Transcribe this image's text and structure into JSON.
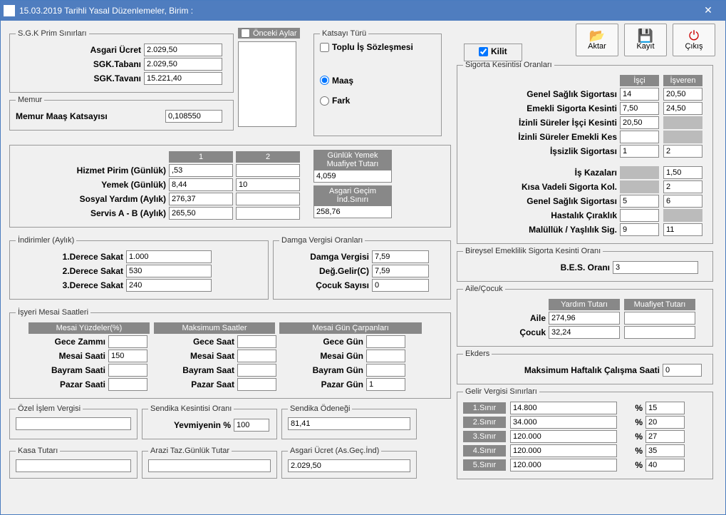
{
  "title": "15.03.2019 Tarihli Yasal Düzenlemeler, Birim :",
  "toolbar": {
    "aktar": "Aktar",
    "kayit": "Kayıt",
    "cikis": "Çıkış"
  },
  "sgk": {
    "legend": "S.G.K Prim Sınırları",
    "asgari_label": "Asgari Ücret",
    "asgari": "2.029,50",
    "taban_label": "SGK.Tabanı",
    "taban": "2.029,50",
    "tavan_label": "SGK.Tavanı",
    "tavan": "15.221,40"
  },
  "memur": {
    "legend": "Memur",
    "katsayi_label": "Memur Maaş Katsayısı",
    "katsayi": "0,108550"
  },
  "onceki": "Önceki Aylar",
  "katsayi": {
    "legend": "Katsayı Türü",
    "toplu": "Toplu İş Sözleşmesi",
    "maas": "Maaş",
    "fark": "Fark"
  },
  "kilit": "Kilit",
  "daily": {
    "col1": "1",
    "col2": "2",
    "hizmet_l": "Hizmet Pirim (Günlük)",
    "hizmet": ",53",
    "yemek_l": "Yemek (Günlük)",
    "yemek1": "8,44",
    "yemek2": "10",
    "sosyal_l": "Sosyal Yardım (Aylık)",
    "sosyal": "276,37",
    "servis_l": "Servis A - B  (Aylık)",
    "servis": "265,50",
    "gunluk_yemek_h": "Günlük Yemek Muafiyet Tutarı",
    "gunluk_yemek": "4,059",
    "asgari_gecim_h": "Asgari Geçim İnd.Sınırı",
    "asgari_gecim": "258,76"
  },
  "indirimler": {
    "legend": "İndirimler (Aylık)",
    "d1_l": "1.Derece Sakat",
    "d1": "1.000",
    "d2_l": "2.Derece Sakat",
    "d2": "530",
    "d3_l": "3.Derece Sakat",
    "d3": "240"
  },
  "damga": {
    "legend": "Damga Vergisi Oranları",
    "dv_l": "Damga Vergisi",
    "dv": "7,59",
    "dg_l": "Değ.Gelir(C)",
    "dg": "7,59",
    "cs_l": "Çocuk Sayısı",
    "cs": "0"
  },
  "mesai": {
    "legend": "İşyeri Mesai Saatleri",
    "h1": "Mesai Yüzdeler(%)",
    "h2": "Maksimum Saatler",
    "h3": "Mesai Gün Çarpanları",
    "gece_l": "Gece Zammı",
    "gece_s_l": "Gece Saat",
    "gece_g_l": "Gece Gün",
    "mesai_l": "Mesai Saati",
    "mesai_v": "150",
    "mesai_s_l": "Mesai Saat",
    "mesai_g_l": "Mesai Gün",
    "bayram_l": "Bayram Saati",
    "bayram_s_l": "Bayram Saat",
    "bayram_g_l": "Bayram Gün",
    "pazar_l": "Pazar Saati",
    "pazar_s_l": "Pazar Saat",
    "pazar_g_l": "Pazar Gün",
    "pazar_g_v": "1"
  },
  "ozel_islem": {
    "legend": "Özel İşlem Vergisi"
  },
  "sendika_k": {
    "legend": "Sendika Kesintisi Oranı",
    "yev_l": "Yevmiyenin %",
    "yev": "100"
  },
  "sendika_o": {
    "legend": "Sendika Ödeneği",
    "v": "81,41"
  },
  "kasa": {
    "legend": "Kasa Tutarı"
  },
  "arazi": {
    "legend": "Arazi Taz.Günlük Tutar"
  },
  "asgari_ind": {
    "legend": "Asgari Ücret (As.Geç.İnd)",
    "v": "2.029,50"
  },
  "sigorta": {
    "legend": "Sigorta Kesintisi Oranları",
    "isci_h": "İşçi",
    "isveren_h": "İşveren",
    "gss_l": "Genel Sağlık Sigortası",
    "gss_i": "14",
    "gss_v": "20,50",
    "emk_l": "Emekli Sigorta Kesinti",
    "emk_i": "7,50",
    "emk_v": "24,50",
    "izin_i_l": "İzinli Süreler İşçi Kesinti",
    "izin_i": "20,50",
    "izin_e_l": "İzinli Süreler Emekli Kes",
    "issiz_l": "İşsizlik Sigortası",
    "issiz_i": "1",
    "issiz_v": "2",
    "kaza_l": "İş Kazaları",
    "kaza_v": "1,50",
    "kisa_l": "Kısa Vadeli Sigorta Kol.",
    "kisa_v": "2",
    "gss2_l": "Genel Sağlık Sigortası",
    "gss2_i": "5",
    "gss2_v": "6",
    "hast_l": "Hastalık Çıraklık",
    "mal_l": "Malüllük / Yaşlılık Sig.",
    "mal_i": "9",
    "mal_v": "11"
  },
  "bes": {
    "legend": "Bireysel Emeklilik Sigorta Kesinti Oranı",
    "l": "B.E.S. Oranı",
    "v": "3"
  },
  "aile": {
    "legend": "Aile/Çocuk",
    "yardim_h": "Yardım Tutarı",
    "muaf_h": "Muafiyet Tutarı",
    "aile_l": "Aile",
    "aile_v": "274,96",
    "cocuk_l": "Çocuk",
    "cocuk_v": "32,24"
  },
  "ekders": {
    "legend": "Ekders",
    "l": "Maksimum Haftalık Çalışma Saati ",
    "v": "0"
  },
  "gelir": {
    "legend": "Gelir Vergisi Sınırları",
    "s1": "1.Sınır",
    "v1": "14.800",
    "p1": "15",
    "s2": "2.Sınır",
    "v2": "34.000",
    "p2": "20",
    "s3": "3.Sınır",
    "v3": "120.000",
    "p3": "27",
    "s4": "4.Sınır",
    "v4": "120.000",
    "p4": "35",
    "s5": "5.Sınır",
    "v5": "120.000",
    "p5": "40",
    "pct": "%"
  }
}
